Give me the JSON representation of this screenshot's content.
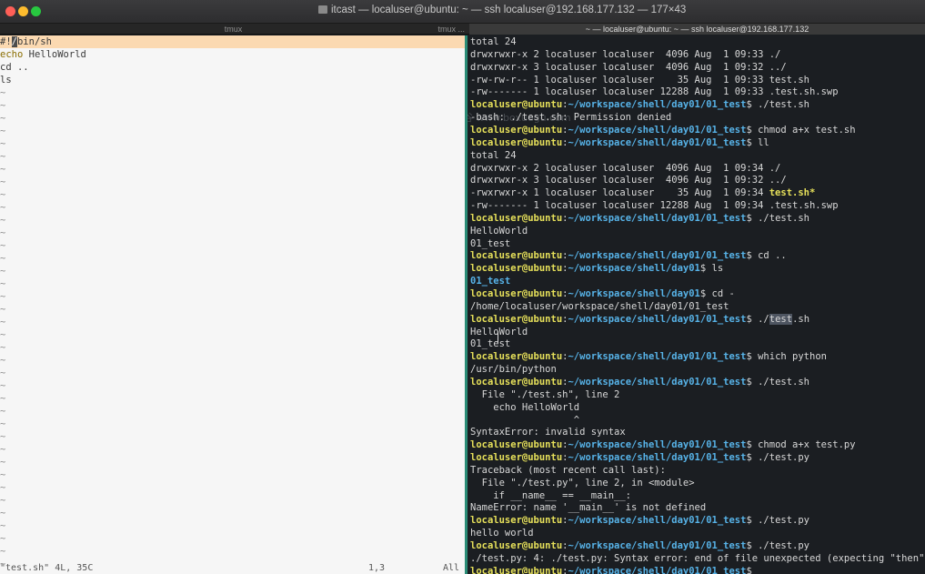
{
  "window": {
    "title": "itcast — localuser@ubuntu: ~ — ssh localuser@192.168.177.132 — 177×43"
  },
  "tabs": {
    "left": "tmux",
    "left_secondary": "tmux ...",
    "right": "~ — localuser@ubuntu: ~ — ssh localuser@192.168.177.132"
  },
  "editor": {
    "lines": [
      "#!/bin/sh",
      "echo HelloWorld",
      "cd ..",
      "ls"
    ],
    "tilde_count": 38,
    "status": {
      "file": "\"test.sh\" 4L, 35C",
      "position": "1,3",
      "scroll": "All"
    }
  },
  "watermark": "博学谷 www.boxuegu.com",
  "terminal": {
    "prompt_user": "localuser@ubuntu",
    "lines": [
      {
        "t": "out",
        "text": "total 24"
      },
      {
        "t": "out",
        "text": "drwxrwxr-x 2 localuser localuser  4096 Aug  1 09:33 ./"
      },
      {
        "t": "out",
        "text": "drwxrwxr-x 3 localuser localuser  4096 Aug  1 09:32 ../"
      },
      {
        "t": "out",
        "text": "-rw-rw-r-- 1 localuser localuser    35 Aug  1 09:33 test.sh"
      },
      {
        "t": "out",
        "text": "-rw------- 1 localuser localuser 12288 Aug  1 09:33 .test.sh.swp"
      },
      {
        "t": "cmd",
        "path": "~/workspace/shell/day01/01_test",
        "cmd": "./test.sh"
      },
      {
        "t": "out",
        "text": "-bash: ./test.sh: Permission denied"
      },
      {
        "t": "cmd",
        "path": "~/workspace/shell/day01/01_test",
        "cmd": "chmod a+x test.sh"
      },
      {
        "t": "cmd",
        "path": "~/workspace/shell/day01/01_test",
        "cmd": "ll"
      },
      {
        "t": "out",
        "text": "total 24"
      },
      {
        "t": "out",
        "text": "drwxrwxr-x 2 localuser localuser  4096 Aug  1 09:34 ./"
      },
      {
        "t": "out",
        "text": "drwxrwxr-x 3 localuser localuser  4096 Aug  1 09:32 ../"
      },
      {
        "t": "exe",
        "text": "-rwxrwxr-x 1 localuser localuser    35 Aug  1 09:34 ",
        "name": "test.sh*"
      },
      {
        "t": "out",
        "text": "-rw------- 1 localuser localuser 12288 Aug  1 09:34 .test.sh.swp"
      },
      {
        "t": "cmd",
        "path": "~/workspace/shell/day01/01_test",
        "cmd": "./test.sh"
      },
      {
        "t": "out",
        "text": "HelloWorld"
      },
      {
        "t": "out",
        "text": "01_test"
      },
      {
        "t": "cmd",
        "path": "~/workspace/shell/day01/01_test",
        "cmd": "cd .."
      },
      {
        "t": "cmd",
        "path": "~/workspace/shell/day01",
        "cmd": "ls"
      },
      {
        "t": "dir",
        "text": "01_test"
      },
      {
        "t": "cmd",
        "path": "~/workspace/shell/day01",
        "cmd": "cd -"
      },
      {
        "t": "out",
        "text": "/home/localuser/workspace/shell/day01/01_test"
      },
      {
        "t": "cmdhl",
        "path": "~/workspace/shell/day01/01_test",
        "cmd_pre": "./",
        "cmd_hl": "test",
        "cmd_post": ".sh"
      },
      {
        "t": "out",
        "text": "HelloWorld"
      },
      {
        "t": "out",
        "text": "01_test"
      },
      {
        "t": "cmd",
        "path": "~/workspace/shell/day01/01_test",
        "cmd": "which python"
      },
      {
        "t": "out",
        "text": "/usr/bin/python"
      },
      {
        "t": "cmd",
        "path": "~/workspace/shell/day01/01_test",
        "cmd": "./test.sh"
      },
      {
        "t": "out",
        "text": "  File \"./test.sh\", line 2"
      },
      {
        "t": "out",
        "text": "    echo HelloWorld"
      },
      {
        "t": "out",
        "text": "                  ^"
      },
      {
        "t": "out",
        "text": "SyntaxError: invalid syntax"
      },
      {
        "t": "cmd",
        "path": "~/workspace/shell/day01/01_test",
        "cmd": "chmod a+x test.py"
      },
      {
        "t": "cmd",
        "path": "~/workspace/shell/day01/01_test",
        "cmd": "./test.py"
      },
      {
        "t": "out",
        "text": "Traceback (most recent call last):"
      },
      {
        "t": "out",
        "text": "  File \"./test.py\", line 2, in <module>"
      },
      {
        "t": "out",
        "text": "    if __name__ == __main__:"
      },
      {
        "t": "out",
        "text": "NameError: name '__main__' is not defined"
      },
      {
        "t": "cmd",
        "path": "~/workspace/shell/day01/01_test",
        "cmd": "./test.py"
      },
      {
        "t": "out",
        "text": "hello world"
      },
      {
        "t": "cmd",
        "path": "~/workspace/shell/day01/01_test",
        "cmd": "./test.py"
      },
      {
        "t": "out",
        "text": "./test.py: 4: ./test.py: Syntax error: end of file unexpected (expecting \"then\")"
      },
      {
        "t": "cmd",
        "path": "~/workspace/shell/day01/01_test",
        "cmd": ""
      }
    ]
  }
}
